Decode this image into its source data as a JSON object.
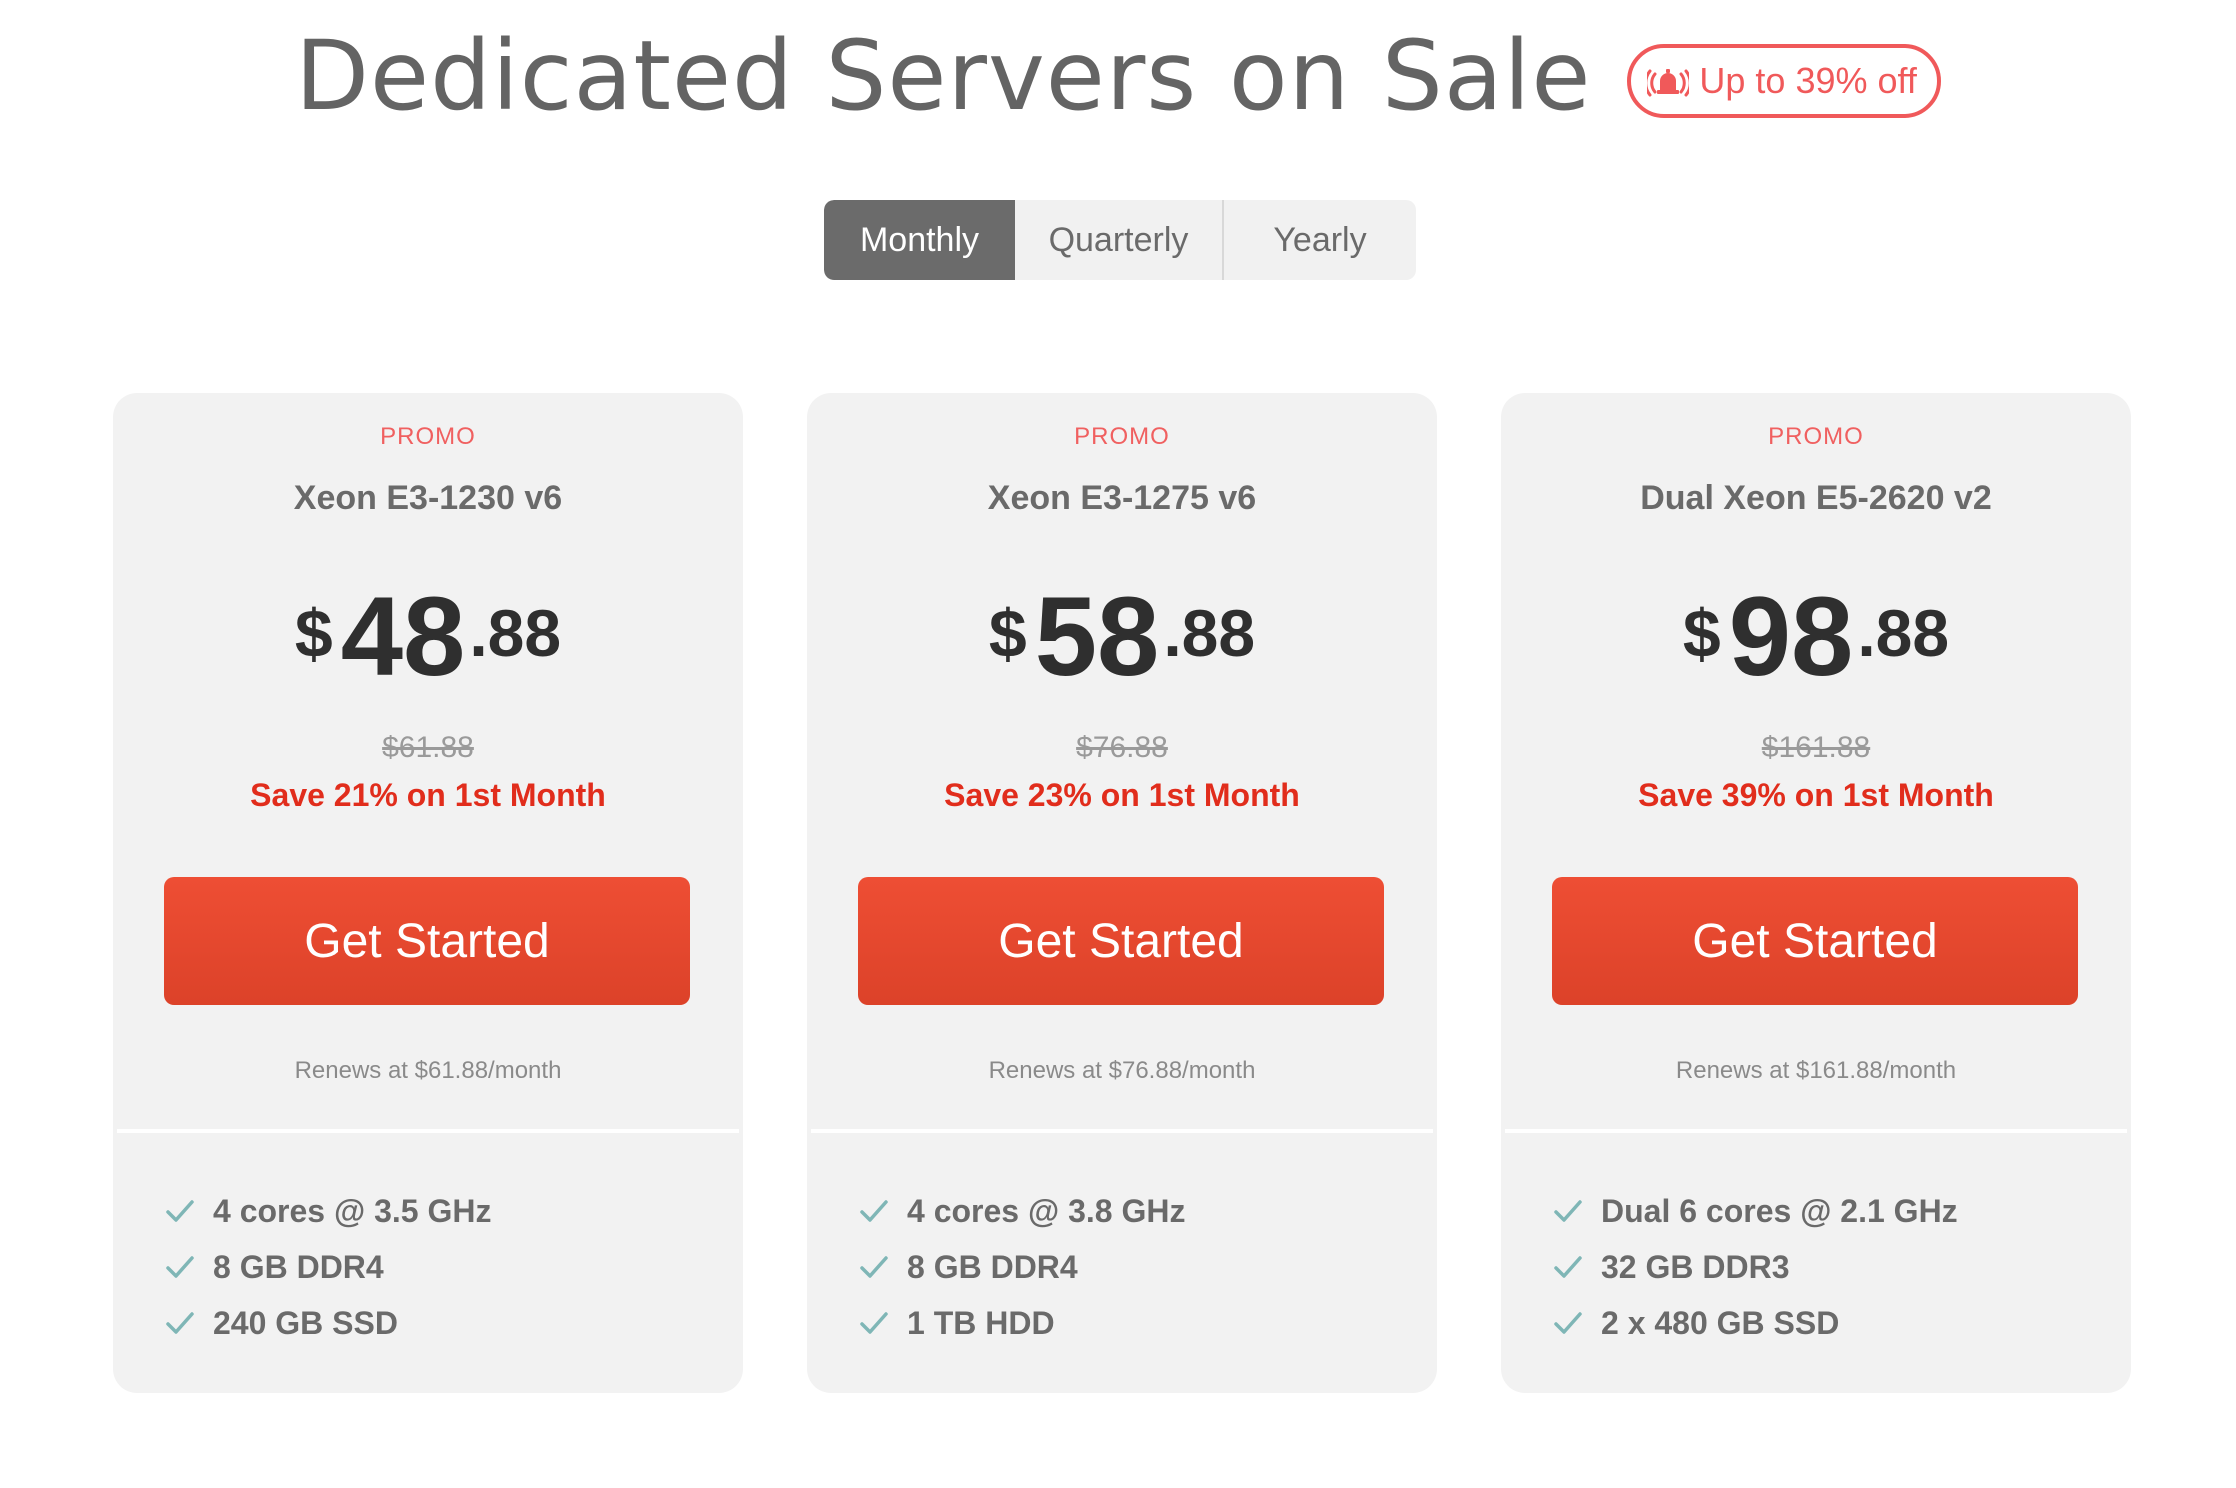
{
  "header": {
    "title": "Dedicated Servers on Sale",
    "badge": "Up to 39% off",
    "badge_icon": "alarm-bell-icon",
    "accent_color": "#f0595a"
  },
  "billing": {
    "options": [
      "Monthly",
      "Quarterly",
      "Yearly"
    ],
    "selected": "Monthly"
  },
  "colors": {
    "cta": "#e84a30",
    "save_text": "#e12d1c",
    "check": "#7fb6b6"
  },
  "plans": [
    {
      "label": "PROMO",
      "name": "Xeon E3-1230 v6",
      "currency": "$",
      "price_whole": "48",
      "price_cents": ".88",
      "old_price": "$61.88",
      "save": "Save 21% on 1st Month",
      "cta": "Get Started",
      "renew": "Renews at $61.88/month",
      "features": [
        "4 cores @ 3.5 GHz",
        "8 GB DDR4",
        "240 GB SSD"
      ]
    },
    {
      "label": "PROMO",
      "name": "Xeon E3-1275 v6",
      "currency": "$",
      "price_whole": "58",
      "price_cents": ".88",
      "old_price": "$76.88",
      "save": "Save 23% on 1st Month",
      "cta": "Get Started",
      "renew": "Renews at $76.88/month",
      "features": [
        "4 cores @ 3.8 GHz",
        "8 GB DDR4",
        "1 TB HDD"
      ]
    },
    {
      "label": "PROMO",
      "name": "Dual Xeon E5-2620 v2",
      "currency": "$",
      "price_whole": "98",
      "price_cents": ".88",
      "old_price": "$161.88",
      "save": "Save 39% on 1st Month",
      "cta": "Get Started",
      "renew": "Renews at $161.88/month",
      "features": [
        "Dual 6 cores @ 2.1 GHz",
        "32 GB DDR3",
        "2 x 480 GB SSD"
      ]
    }
  ]
}
